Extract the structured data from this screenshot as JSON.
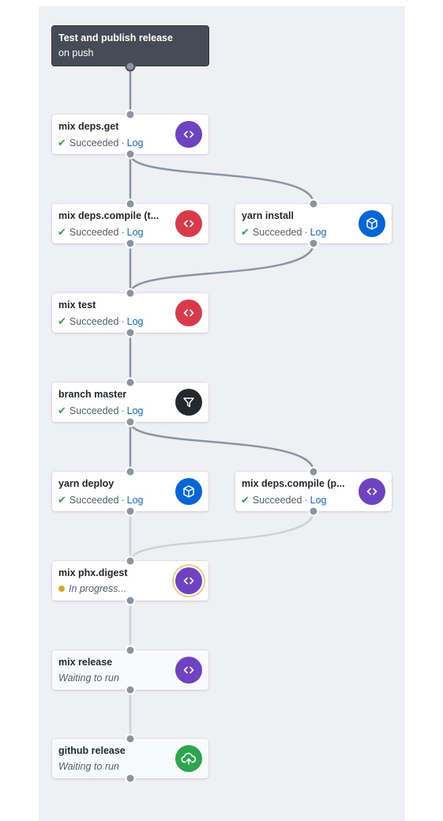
{
  "workflow": {
    "trigger": {
      "title": "Test and publish release",
      "subtitle": "on push"
    },
    "colors": {
      "purple": "#6f42c1",
      "red": "#d73a49",
      "blue": "#0366d6",
      "dark": "#24292e",
      "green": "#2ea44f",
      "success_check": "#2da44e",
      "in_progress": "#d4a72c",
      "link": "#0969da"
    },
    "nodes": [
      {
        "id": "deps_get",
        "title": "mix deps.get",
        "status": "Succeeded",
        "log": "Log",
        "state": "success",
        "icon": "code-icon",
        "color": "purple"
      },
      {
        "id": "deps_compile_t",
        "title": "mix deps.compile (t...",
        "status": "Succeeded",
        "log": "Log",
        "state": "success",
        "icon": "code-icon",
        "color": "red"
      },
      {
        "id": "yarn_install",
        "title": "yarn install",
        "status": "Succeeded",
        "log": "Log",
        "state": "success",
        "icon": "package-icon",
        "color": "blue"
      },
      {
        "id": "mix_test",
        "title": "mix test",
        "status": "Succeeded",
        "log": "Log",
        "state": "success",
        "icon": "code-icon",
        "color": "red"
      },
      {
        "id": "branch_master",
        "title": "branch master",
        "status": "Succeeded",
        "log": "Log",
        "state": "success",
        "icon": "filter-icon",
        "color": "dark"
      },
      {
        "id": "yarn_deploy",
        "title": "yarn deploy",
        "status": "Succeeded",
        "log": "Log",
        "state": "success",
        "icon": "package-icon",
        "color": "blue"
      },
      {
        "id": "deps_compile_p",
        "title": "mix deps.compile (p...",
        "status": "Succeeded",
        "log": "Log",
        "state": "success",
        "icon": "code-icon",
        "color": "purple"
      },
      {
        "id": "phx_digest",
        "title": "mix phx.digest",
        "status": "In progress...",
        "log": "",
        "state": "in_progress",
        "icon": "code-icon",
        "color": "purple"
      },
      {
        "id": "mix_release",
        "title": "mix release",
        "status": "Waiting to run",
        "log": "",
        "state": "waiting",
        "icon": "code-icon",
        "color": "purple"
      },
      {
        "id": "github_release",
        "title": "github release",
        "status": "Waiting to run",
        "log": "",
        "state": "waiting",
        "icon": "upload-cloud-icon",
        "color": "green"
      }
    ],
    "edges": [
      {
        "from": "trigger",
        "to": "deps_get",
        "state": "done"
      },
      {
        "from": "deps_get",
        "to": "deps_compile_t",
        "state": "done"
      },
      {
        "from": "deps_get",
        "to": "yarn_install",
        "state": "done"
      },
      {
        "from": "deps_compile_t",
        "to": "mix_test",
        "state": "done"
      },
      {
        "from": "yarn_install",
        "to": "mix_test",
        "state": "done"
      },
      {
        "from": "mix_test",
        "to": "branch_master",
        "state": "done"
      },
      {
        "from": "branch_master",
        "to": "yarn_deploy",
        "state": "done"
      },
      {
        "from": "branch_master",
        "to": "deps_compile_p",
        "state": "done"
      },
      {
        "from": "yarn_deploy",
        "to": "phx_digest",
        "state": "pending"
      },
      {
        "from": "deps_compile_p",
        "to": "phx_digest",
        "state": "pending"
      },
      {
        "from": "phx_digest",
        "to": "mix_release",
        "state": "pending"
      },
      {
        "from": "mix_release",
        "to": "github_release",
        "state": "pending"
      }
    ]
  }
}
